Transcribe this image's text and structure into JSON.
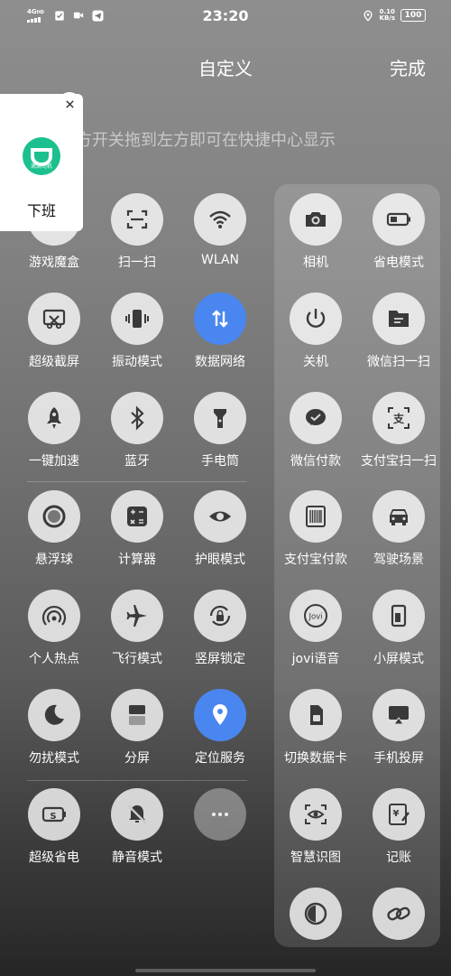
{
  "status_bar": {
    "network": "4G",
    "network_sub": "HD",
    "time": "23:20",
    "net_speed_value": "0.10",
    "net_speed_unit": "KB/s",
    "battery": "100"
  },
  "header": {
    "title": "自定义",
    "done_label": "完成"
  },
  "hint": "左方开关拖到左方即可在快捷中心显示",
  "popup": {
    "label": "下班",
    "logo_text": "滴滴司机"
  },
  "left_tiles": [
    {
      "label": "游戏魔盒",
      "icon": "game-box-icon"
    },
    {
      "label": "扫一扫",
      "icon": "scan-icon"
    },
    {
      "label": "WLAN",
      "icon": "wifi-icon"
    },
    {
      "label": "超级截屏",
      "icon": "screenshot-icon"
    },
    {
      "label": "振动模式",
      "icon": "vibrate-icon"
    },
    {
      "label": "数据网络",
      "icon": "mobile-data-icon",
      "active": true
    },
    {
      "label": "一键加速",
      "icon": "rocket-icon"
    },
    {
      "label": "蓝牙",
      "icon": "bluetooth-icon"
    },
    {
      "label": "手电筒",
      "icon": "flashlight-icon"
    },
    {
      "label": "悬浮球",
      "icon": "float-ball-icon"
    },
    {
      "label": "计算器",
      "icon": "calculator-icon"
    },
    {
      "label": "护眼模式",
      "icon": "eye-icon"
    },
    {
      "label": "个人热点",
      "icon": "hotspot-icon"
    },
    {
      "label": "飞行模式",
      "icon": "airplane-icon"
    },
    {
      "label": "竖屏锁定",
      "icon": "rotation-lock-icon"
    },
    {
      "label": "勿扰模式",
      "icon": "moon-icon"
    },
    {
      "label": "分屏",
      "icon": "split-screen-icon"
    },
    {
      "label": "定位服务",
      "icon": "location-icon",
      "active": true
    },
    {
      "label": "超级省电",
      "icon": "super-power-save-icon"
    },
    {
      "label": "静音模式",
      "icon": "mute-bell-icon"
    },
    {
      "label": "",
      "icon": "more-icon"
    }
  ],
  "right_tiles": [
    {
      "label": "相机",
      "icon": "camera-icon"
    },
    {
      "label": "省电模式",
      "icon": "battery-icon"
    },
    {
      "label": "关机",
      "icon": "power-icon"
    },
    {
      "label": "微信扫一扫",
      "icon": "wechat-scan-icon"
    },
    {
      "label": "微信付款",
      "icon": "wechat-pay-icon"
    },
    {
      "label": "支付宝扫一扫",
      "icon": "alipay-scan-icon"
    },
    {
      "label": "支付宝付款",
      "icon": "barcode-icon"
    },
    {
      "label": "驾驶场景",
      "icon": "car-icon"
    },
    {
      "label": "jovi语音",
      "icon": "jovi-icon"
    },
    {
      "label": "小屏模式",
      "icon": "small-screen-icon"
    },
    {
      "label": "切换数据卡",
      "icon": "sim-card-icon"
    },
    {
      "label": "手机投屏",
      "icon": "cast-icon"
    },
    {
      "label": "智慧识图",
      "icon": "smart-vision-icon"
    },
    {
      "label": "记账",
      "icon": "bookkeeping-icon"
    },
    {
      "label": "",
      "icon": "contrast-icon"
    },
    {
      "label": "",
      "icon": "link-icon"
    }
  ],
  "colors": {
    "active": "#4a86f0",
    "tile": "rgba(255,255,255,0.78)",
    "icon": "#3a3a3a"
  }
}
